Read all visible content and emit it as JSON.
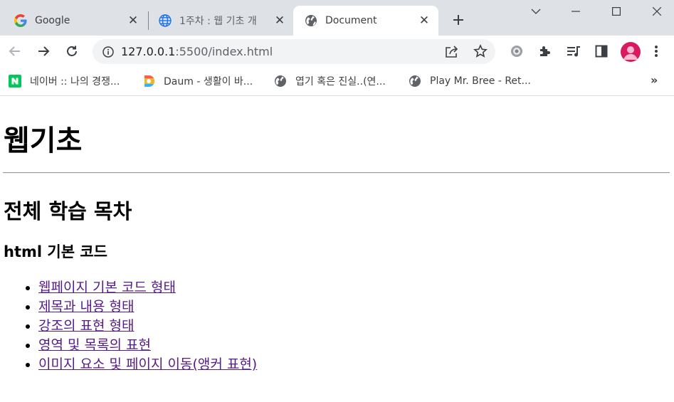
{
  "browser": {
    "tabs": [
      {
        "title": "Google",
        "icon": "google-icon",
        "active": false
      },
      {
        "title": "1주차 : 웹 기초 개",
        "icon": "globe-icon",
        "active": false
      },
      {
        "title": "Document",
        "icon": "globe-icon",
        "active": true
      }
    ],
    "url_host": "127.0.0.1",
    "url_rest": ":5500/index.html",
    "bookmarks": [
      {
        "label": "네이버 :: 나의 경쟁...",
        "icon": "naver-icon"
      },
      {
        "label": "Daum - 생활이 바...",
        "icon": "daum-icon"
      },
      {
        "label": "엽기 혹은 진실..(연...",
        "icon": "globe-icon"
      },
      {
        "label": "Play Mr. Bree - Ret...",
        "icon": "globe-icon"
      }
    ],
    "colors": {
      "tabstrip": "#dee1e6",
      "omnibox": "#f1f3f4",
      "avatar": "#d81b60",
      "naver": "#03c75a"
    }
  },
  "page": {
    "h1": "웹기초",
    "h2": "전체 학습 목차",
    "h3": "html 기본 코드",
    "links": [
      "웹페이지 기본 코드 형태",
      "제목과 내용 형태",
      "강조의 표현 형태",
      "영역 및 목록의 표현",
      "이미지 요소 및 페이지 이동(앵커 표현)"
    ],
    "link_color": "#551a8b"
  }
}
